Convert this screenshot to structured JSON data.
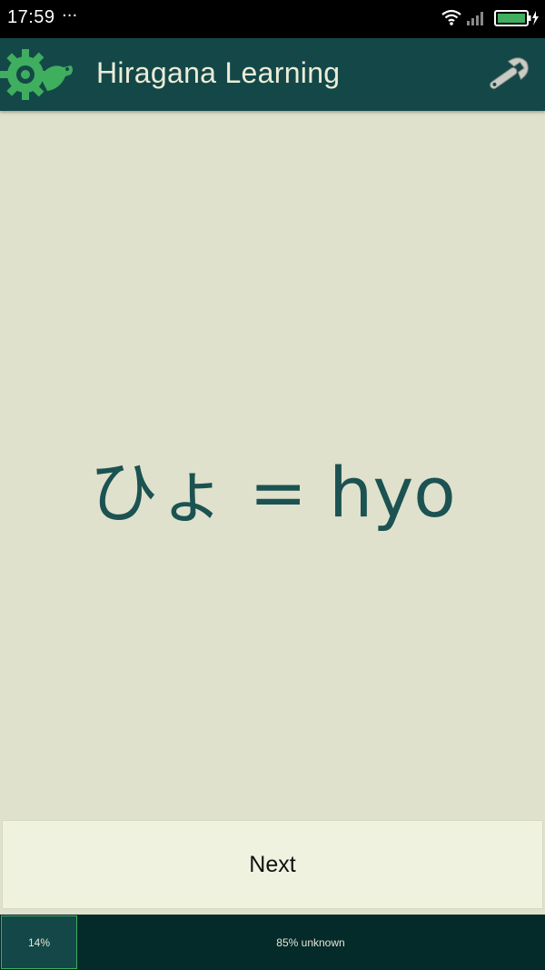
{
  "status_bar": {
    "time": "17:59",
    "overflow_indicator": "···",
    "icons": [
      "wifi-icon",
      "signal-icon",
      "battery-charging-icon"
    ]
  },
  "app_bar": {
    "title": "Hiragana Learning",
    "logo_icon": "gear-turtle-logo-icon",
    "settings_icon": "wrench-icon"
  },
  "card": {
    "text": "ひょ = hyo"
  },
  "actions": {
    "next_label": "Next"
  },
  "progress": {
    "known_label": "14%",
    "unknown_label": "85% unknown",
    "known_fraction": 0.14
  },
  "colors": {
    "app_bar": "#144848",
    "background": "#dfe1cd",
    "card_text": "#1c5252",
    "logo_green": "#3fae5e",
    "progress_background": "#052a2a"
  }
}
